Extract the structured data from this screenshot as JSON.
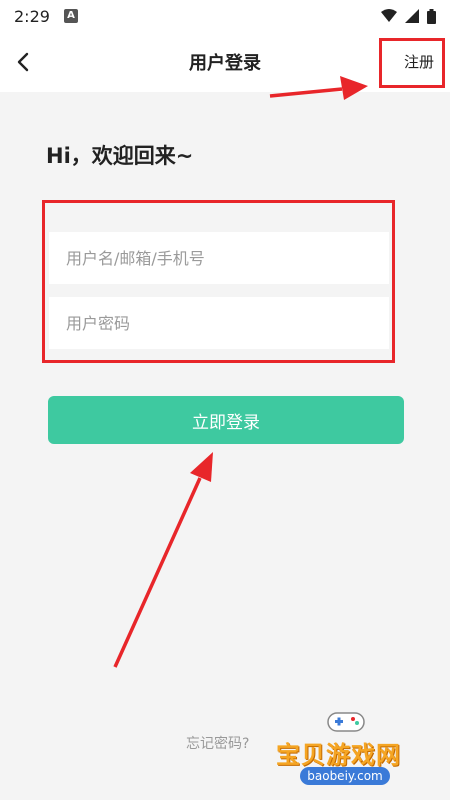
{
  "status_bar": {
    "time": "2:29",
    "app_indicator": "A",
    "icons": [
      "wifi-icon",
      "signal-icon",
      "battery-icon"
    ]
  },
  "nav": {
    "back_icon": "chevron-left-icon",
    "title": "用户登录",
    "register_label": "注册"
  },
  "form": {
    "greeting": "Hi，欢迎回来~",
    "username_placeholder": "用户名/邮箱/手机号",
    "username_value": "",
    "password_placeholder": "用户密码",
    "password_value": "",
    "login_label": "立即登录",
    "forgot_label": "忘记密码?"
  },
  "watermark": {
    "text": "宝贝游戏网",
    "url": "baobeiy.com"
  },
  "colors": {
    "accent": "#3ec9a0",
    "annotation": "#e8262a",
    "background": "#f4f4f4"
  }
}
